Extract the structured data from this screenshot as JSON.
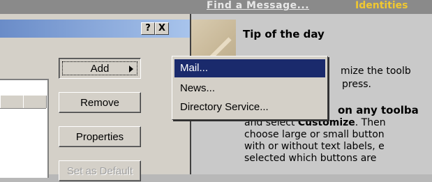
{
  "oe": {
    "find_link": "Find a Message...",
    "identities_link": "Identities",
    "tip_title": "Tip of the day",
    "tip_lines": [
      "mize the toolb",
      "press.",
      "on any toolba",
      "and select ",
      "Customize",
      ". Then",
      "choose large or small button",
      "with or without text labels, e",
      "selected which buttons are"
    ]
  },
  "dialog": {
    "help_button": "?",
    "close_button": "X",
    "buttons": {
      "add": "Add",
      "remove": "Remove",
      "properties": "Properties",
      "set_default": "Set as Default"
    }
  },
  "menu": {
    "items": [
      "Mail...",
      "News...",
      "Directory Service..."
    ],
    "selected_index": 0
  }
}
